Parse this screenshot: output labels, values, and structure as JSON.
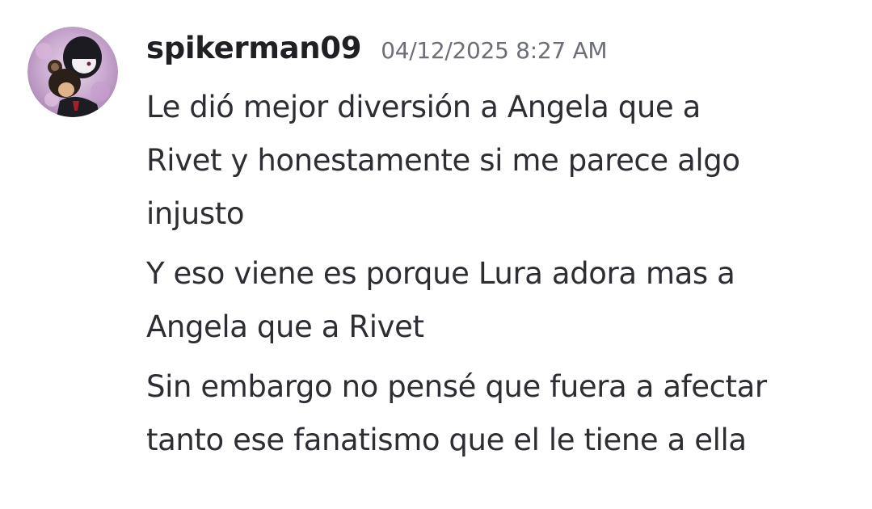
{
  "message": {
    "author": "spikerman09",
    "timestamp": "04/12/2025 8:27 AM",
    "avatar_icon": "user-avatar-icon",
    "lines": [
      "Le dió mejor diversión a Angela que a\nRivet y honestamente si me parece algo\ninjusto",
      "Y eso viene es porque Lura adora mas a\nAngela que a Rivet",
      "Sin embargo no pensé que fuera a afectar\ntanto ese fanatismo que el le tiene a ella"
    ]
  },
  "colors": {
    "background": "#ffffff",
    "author": "#1f1f24",
    "timestamp": "#6c6f78",
    "text": "#2d2e33"
  }
}
